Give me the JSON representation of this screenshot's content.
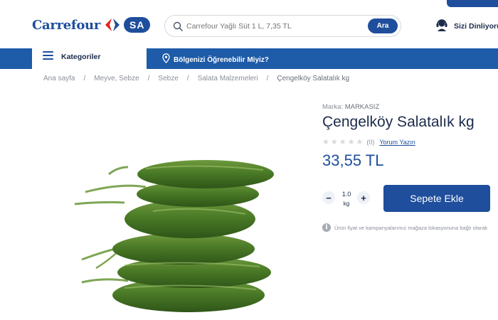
{
  "header": {
    "logo_text": "Carrefour",
    "logo_badge": "SA",
    "search": {
      "placeholder": "Carrefour Yağlı Süt 1 L, 7,35 TL",
      "button_label": "Ara"
    },
    "account_label": "Sizi Dinliyoruz"
  },
  "nav": {
    "categories_label": "Kategoriler",
    "region_label": "Bölgenizi Öğrenebilir Miyiz?"
  },
  "breadcrumb": [
    "Ana sayfa",
    "Meyve, Sebze",
    "Sebze",
    "Salata Malzemeleri",
    "Çengelköy Salatalık kg"
  ],
  "product": {
    "brand_label": "Marka:",
    "brand": "MARKASIZ",
    "title": "Çengelköy Salatalık kg",
    "rating_stars": 0,
    "review_count": "(0)",
    "review_link": "Yorum Yazın",
    "price": "33,55 TL",
    "quantity": "1.0",
    "unit": "kg",
    "add_to_cart": "Sepete Ekle",
    "info_note": "Ürün fiyat ve kampanyalarımız mağaza lokasyonuna bağlı olarak"
  },
  "colors": {
    "brand_blue": "#1e4e9c",
    "nav_blue": "#1e5ba8",
    "brand_red": "#e2231a"
  }
}
